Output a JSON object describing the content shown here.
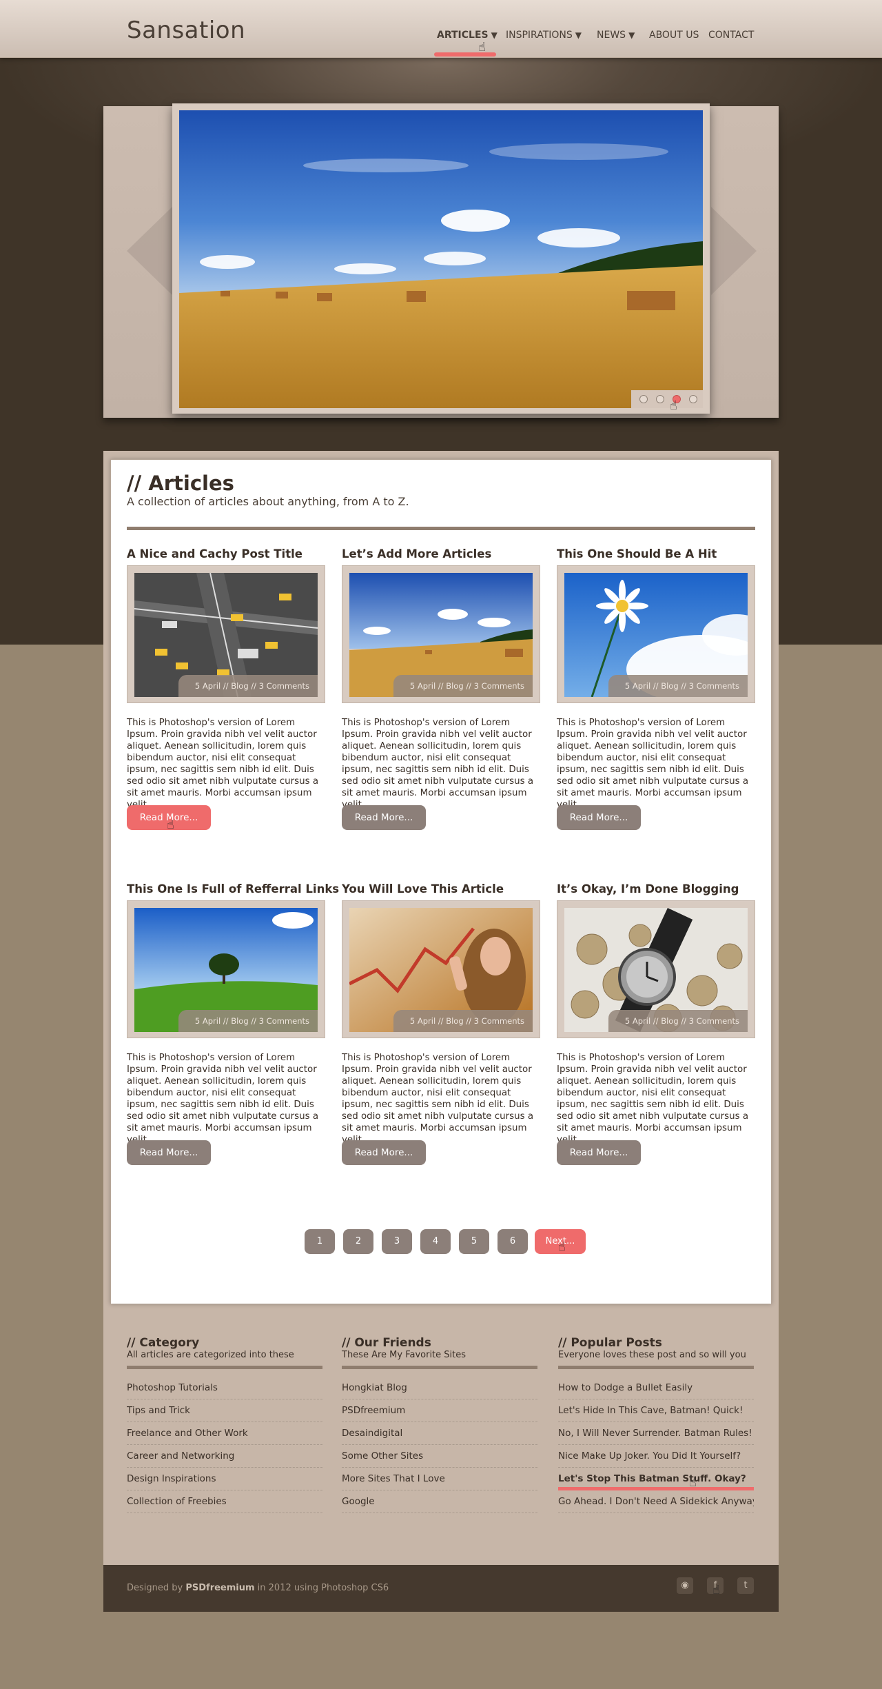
{
  "header": {
    "logo": "Sansation",
    "nav": [
      {
        "label": "ARTICLES",
        "caret": "▼",
        "active": true
      },
      {
        "label": "INSPIRATIONS",
        "caret": "▼"
      },
      {
        "label": "NEWS",
        "caret": "▼"
      },
      {
        "label": "ABOUT US",
        "caret": ""
      },
      {
        "label": "CONTACT",
        "caret": ""
      }
    ]
  },
  "slider": {
    "arrow_left_icon": "triangle-left-icon",
    "arrow_right_icon": "triangle-right-icon",
    "dot_count": 4,
    "active_dot": 3
  },
  "articles_section": {
    "title": "// Articles",
    "subtitle": "A collection of articles about anything, from A to Z.",
    "items": [
      {
        "title": "A Nice and Cachy Post Title",
        "meta": "5 April // Blog // 3 Comments",
        "excerpt": "This is Photoshop's version  of Lorem Ipsum. Proin gravida nibh vel velit auctor aliquet. Aenean sollicitudin, lorem quis bibendum auctor, nisi elit consequat ipsum, nec sagittis sem nibh id elit. Duis sed odio sit amet nibh vulputate cursus a sit amet mauris. Morbi accumsan ipsum velit.",
        "button": "Read More..."
      },
      {
        "title": "Let’s Add More Articles",
        "meta": "5 April // Blog // 3 Comments",
        "excerpt": "This is Photoshop's version  of Lorem Ipsum. Proin gravida nibh vel velit auctor aliquet. Aenean sollicitudin, lorem quis bibendum auctor, nisi elit consequat ipsum, nec sagittis sem nibh id elit. Duis sed odio sit amet nibh vulputate cursus a sit amet mauris. Morbi accumsan ipsum velit.",
        "button": "Read More..."
      },
      {
        "title": "This One Should Be A Hit",
        "meta": "5 April // Blog // 3 Comments",
        "excerpt": "This is Photoshop's version  of Lorem Ipsum. Proin gravida nibh vel velit auctor aliquet. Aenean sollicitudin, lorem quis bibendum auctor, nisi elit consequat ipsum, nec sagittis sem nibh id elit. Duis sed odio sit amet nibh vulputate cursus a sit amet mauris. Morbi accumsan ipsum velit.",
        "button": "Read More..."
      },
      {
        "title": "This One Is Full of Refferral Links",
        "meta": "5 April // Blog // 3 Comments",
        "excerpt": "This is Photoshop's version  of Lorem Ipsum. Proin gravida nibh vel velit auctor aliquet. Aenean sollicitudin, lorem quis bibendum auctor, nisi elit consequat ipsum, nec sagittis sem nibh id elit. Duis sed odio sit amet nibh vulputate cursus a sit amet mauris. Morbi accumsan ipsum velit.",
        "button": "Read More..."
      },
      {
        "title": "You Will Love This Article",
        "meta": "5 April // Blog // 3 Comments",
        "excerpt": "This is Photoshop's version  of Lorem Ipsum. Proin gravida nibh vel velit auctor aliquet. Aenean sollicitudin, lorem quis bibendum auctor, nisi elit consequat ipsum, nec sagittis sem nibh id elit. Duis sed odio sit amet nibh vulputate cursus a sit amet mauris. Morbi accumsan ipsum velit.",
        "button": "Read More..."
      },
      {
        "title": "It’s Okay, I’m Done Blogging",
        "meta": "5 April // Blog // 3 Comments",
        "excerpt": "This is Photoshop's version  of Lorem Ipsum. Proin gravida nibh vel velit auctor aliquet. Aenean sollicitudin, lorem quis bibendum auctor, nisi elit consequat ipsum, nec sagittis sem nibh id elit. Duis sed odio sit amet nibh vulputate cursus a sit amet mauris. Morbi accumsan ipsum velit.",
        "button": "Read More..."
      }
    ]
  },
  "pagination": {
    "pages": [
      "1",
      "2",
      "3",
      "4",
      "5",
      "6"
    ],
    "next": "Next..."
  },
  "footer_columns": [
    {
      "title": "// Category",
      "subtitle": "All articles are categorized into these",
      "items": [
        "Photoshop Tutorials",
        "Tips and Trick",
        "Freelance and Other Work",
        "Career and Networking",
        "Design Inspirations",
        "Collection of Freebies"
      ]
    },
    {
      "title": "// Our Friends",
      "subtitle": "These Are My Favorite Sites",
      "items": [
        "Hongkiat Blog",
        "PSDfreemium",
        "Desaindigital",
        "Some Other Sites",
        "More Sites That I Love",
        "Google"
      ]
    },
    {
      "title": "// Popular Posts",
      "subtitle": "Everyone loves these post and so will you",
      "items": [
        "How to Dodge a Bullet Easily",
        "Let's Hide In This Cave, Batman! Quick!",
        "No, I Will Never Surrender. Batman Rules!",
        "Nice Make Up Joker. You Did It Yourself?",
        "Let's Stop This Batman Stuff. Okay?",
        "Go Ahead. I Don't Need A Sidekick Anyway."
      ]
    }
  ],
  "footer": {
    "prefix": "Designed by ",
    "brand": "PSDfreemium",
    "suffix": " in 2012 using Photoshop CS6",
    "social": [
      {
        "icon": "rss-icon",
        "glyph": "◉"
      },
      {
        "icon": "facebook-icon",
        "glyph": "f"
      },
      {
        "icon": "twitter-icon",
        "glyph": "t"
      }
    ]
  },
  "colors": {
    "accent": "#ef6b6b",
    "button": "#8c7f79",
    "dark": "#45392e"
  }
}
